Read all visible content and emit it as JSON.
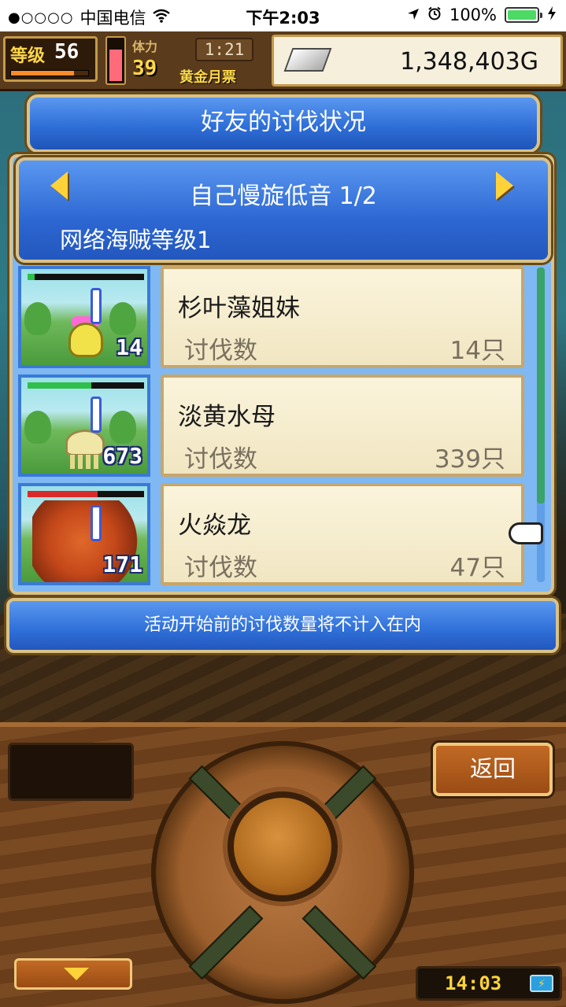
{
  "status_bar": {
    "signal_dots": "●○○○○",
    "carrier": "中国电信",
    "time": "下午2:03",
    "battery_percent": "100%",
    "battery_level": 1.0
  },
  "hud": {
    "level_label": "等级",
    "level_value": "56",
    "level_progress": 0.82,
    "gauge_level": 0.75,
    "stamina_label": "体力",
    "stamina_value": "39",
    "timer": "1:21",
    "ticket_label": "黄金月票",
    "gold": "1,348,403G"
  },
  "dialog": {
    "title": "好友的讨伐状况",
    "friend_name": "自己慢旋低音 1/2",
    "friend_sub": "网络海贼等级1",
    "kill_label": "讨伐数",
    "monsters": [
      {
        "name": "杉叶藻姐妹",
        "kills": "14只",
        "thumb_count": "14",
        "hp_color": "#2fbf4a",
        "hp_fill": 0.06
      },
      {
        "name": "淡黄水母",
        "kills": "339只",
        "thumb_count": "673",
        "hp_color": "#2fbf4a",
        "hp_fill": 0.55
      },
      {
        "name": "火焱龙",
        "kills": "47只",
        "thumb_count": "171",
        "hp_color": "#d82a2a",
        "hp_fill": 0.6
      }
    ],
    "note": "活动开始前的讨伐数量将不计入在内"
  },
  "controls": {
    "back_label": "返回",
    "clock": "14:03",
    "clock_icon": "⚡"
  },
  "colors": {
    "panel_blue": "#2f6fd8",
    "gold_border": "#d9c28a",
    "wood": "#7a4a22"
  }
}
